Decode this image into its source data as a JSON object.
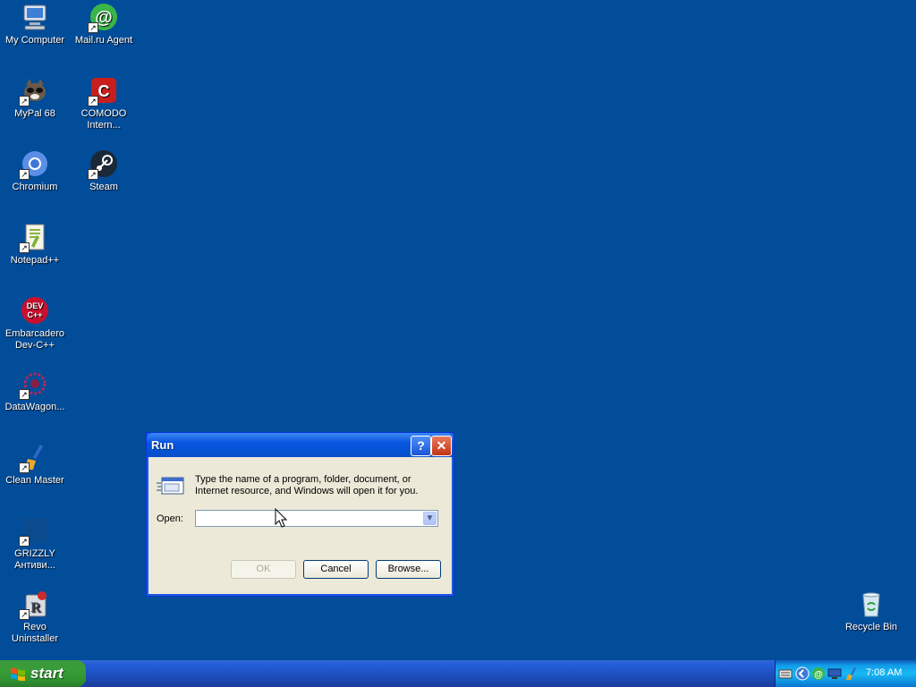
{
  "desktop": {
    "icons": [
      {
        "label": "My Computer",
        "icon": "my-computer-icon"
      },
      {
        "label": "Mail.ru Agent",
        "icon": "mail-ru-agent-icon"
      },
      {
        "label": "MyPal 68",
        "icon": "mypal-icon"
      },
      {
        "label": "COMODO Intern...",
        "icon": "comodo-icon"
      },
      {
        "label": "Chromium",
        "icon": "chromium-icon"
      },
      {
        "label": "Steam",
        "icon": "steam-icon"
      },
      {
        "label": "Notepad++",
        "icon": "notepadpp-icon"
      },
      {
        "label": "Embarcadero Dev-C++",
        "icon": "devcpp-icon"
      },
      {
        "label": "DataWagon...",
        "icon": "datawagon-icon"
      },
      {
        "label": "Clean Master",
        "icon": "clean-master-icon"
      },
      {
        "label": "GRIZZLY Антиви...",
        "icon": "grizzly-icon"
      },
      {
        "label": "Revo Uninstaller",
        "icon": "revo-uninstaller-icon"
      },
      {
        "label": "Recycle Bin",
        "icon": "recycle-bin-icon"
      }
    ]
  },
  "run_dialog": {
    "title": "Run",
    "help_glyph": "?",
    "close_glyph": "✕",
    "description": "Type the name of a program, folder, document, or Internet resource, and Windows will open it for you.",
    "open_label": "Open:",
    "open_value": "",
    "ok_label": "OK",
    "cancel_label": "Cancel",
    "browse_label": "Browse..."
  },
  "taskbar": {
    "start_label": "start",
    "clock": "7:08 AM",
    "tray_icons": [
      "keyboard-icon",
      "chromium-tray-icon",
      "mail-ru-tray-icon",
      "network-icon",
      "broom-icon"
    ]
  },
  "colors": {
    "desktop_bg": "#024d9a",
    "title_blue": "#0a54e2",
    "start_green": "#379d37",
    "tray_blue": "#18b9f5",
    "dialog_face": "#ece9d8"
  }
}
